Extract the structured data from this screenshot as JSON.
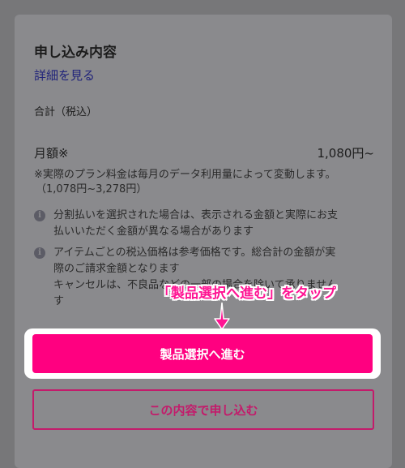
{
  "summary": {
    "title": "申し込み内容",
    "details_link": "詳細を見る",
    "total_label": "合計（税込）",
    "monthly_label": "月額※",
    "monthly_price": "1,080円~",
    "note_line1": "※実際のプラン料金は毎月のデータ利用量によって変動します。",
    "note_line2": "（1,078円~3,278円）"
  },
  "info": [
    {
      "icon": "info-icon",
      "icon_glyph": "i",
      "lines": [
        "分割払いを選択された場合は、表示される金額と実際にお支",
        "払いいただく金額が異なる場合があります"
      ]
    },
    {
      "icon": "info-icon",
      "icon_glyph": "i",
      "lines": [
        "アイテムごとの税込価格は参考価格です。総合計の金額が実",
        "際のご請求金額となります",
        "キャンセルは、不良品などの一部の場合を除いて承りません",
        "す"
      ]
    }
  ],
  "annotation": {
    "callout": "「製品選択へ進む」をタップ",
    "color": "#ff1493"
  },
  "actions": {
    "primary_label": "製品選択へ進む",
    "secondary_label": "この内容で申し込む",
    "primary_color": "#ff0080",
    "secondary_color": "#c31b6b"
  }
}
